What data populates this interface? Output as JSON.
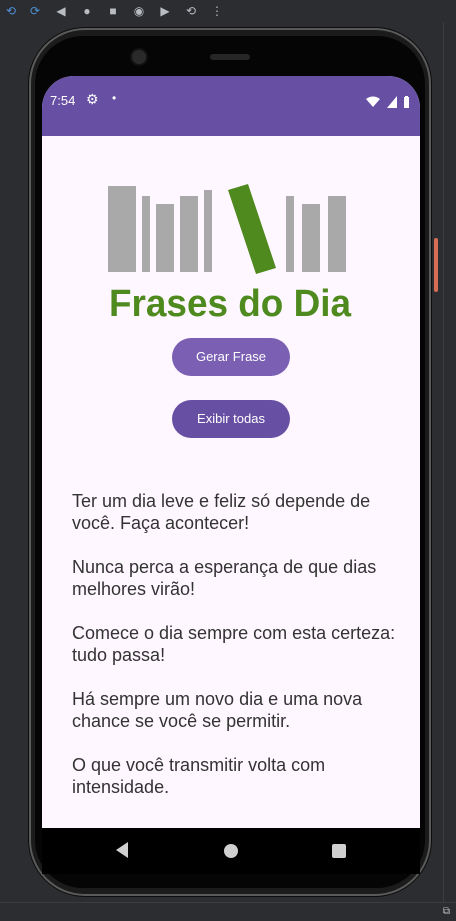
{
  "status": {
    "time": "7:54"
  },
  "logo": {
    "text": "Frases do Dia"
  },
  "buttons": {
    "generate": "Gerar Frase",
    "show_all": "Exibir todas"
  },
  "phrases": [
    "Ter um dia leve e feliz só depende de você. Faça acontecer!",
    "Nunca perca a esperança de que dias melhores virão!",
    "Comece o dia sempre com esta certeza: tudo passa!",
    "Há sempre um novo dia e uma nova chance se você se permitir.",
    "O que você transmitir volta com intensidade."
  ],
  "colors": {
    "app_bar": "#6750a4",
    "button_primary": "#6750a4",
    "button_secondary": "#7a5fb3",
    "logo_green": "#4e8a1e",
    "logo_gray": "#a9a9a9"
  },
  "icons": {
    "toolbar": [
      "rotate-left-icon",
      "rotate-right-icon",
      "back-icon",
      "home-icon",
      "overview-icon",
      "camera-icon",
      "record-icon",
      "snapshot-icon",
      "more-icon"
    ],
    "status": [
      "gear-icon",
      "dot-icon",
      "wifi-icon",
      "cellular-icon",
      "battery-icon"
    ]
  }
}
